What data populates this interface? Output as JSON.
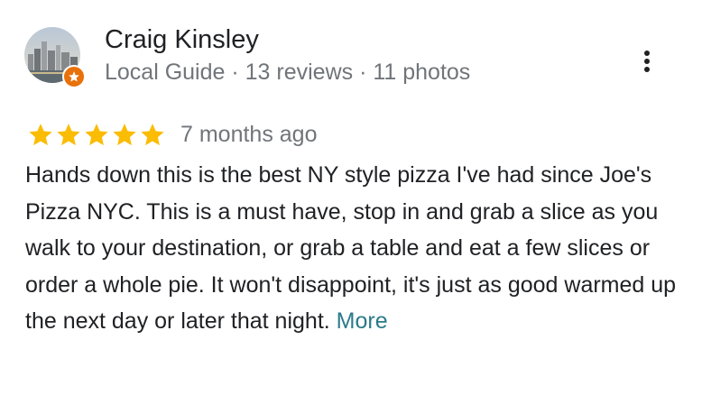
{
  "reviewer": {
    "name": "Craig Kinsley",
    "meta": "Local Guide · 13 reviews · 11 photos"
  },
  "review": {
    "rating": 5,
    "rating_max": 5,
    "date": "7 months ago",
    "text": "Hands down this is the best NY style pizza I've had since Joe's Pizza NYC. This is a must have, stop in and grab a slice as you walk to your destination, or grab a table and eat a few slices or order a whole pie. It won't disappoint, it's just as good warmed up the next day or later that night.",
    "more_label": "More"
  },
  "icons": {
    "more_options": "more-vertical-icon",
    "badge": "local-guide-star-icon",
    "star": "star-icon"
  },
  "colors": {
    "star": "#fbbc04",
    "badge": "#e8710a",
    "meta_text": "#70757a",
    "link": "#2b7a8a"
  }
}
